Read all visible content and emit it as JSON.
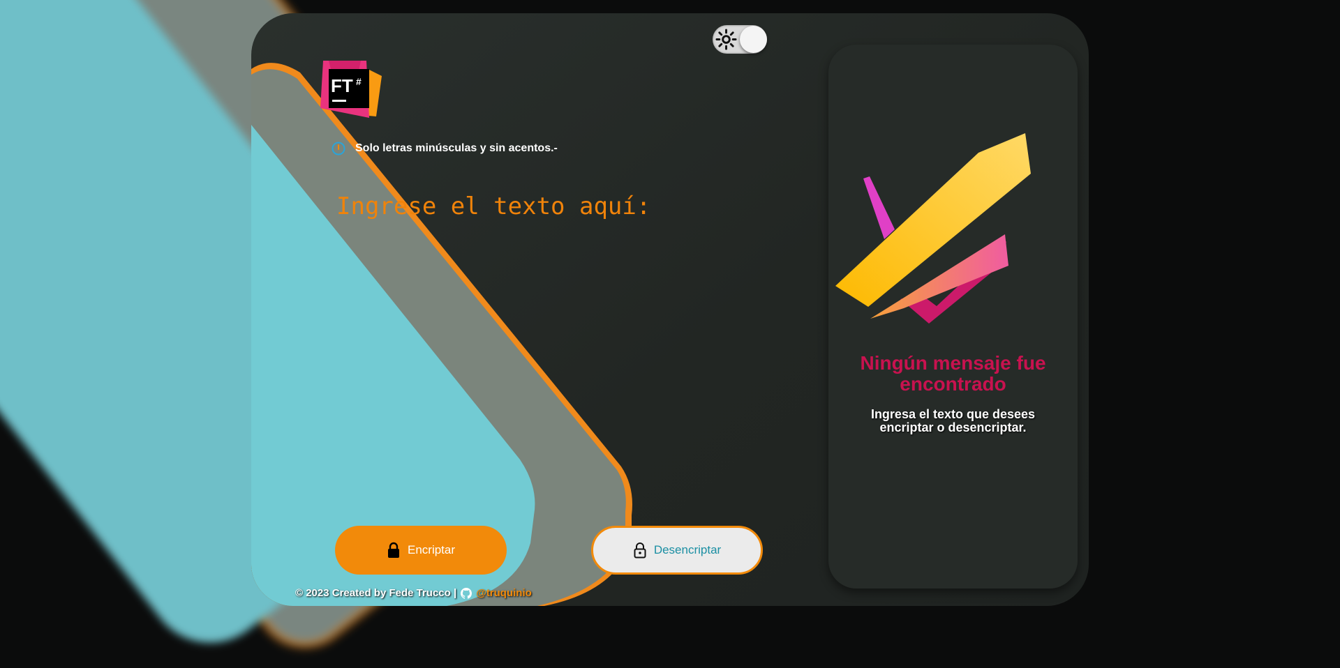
{
  "theme_toggle": {
    "icon": "sun-icon",
    "state": "light"
  },
  "logo": {
    "text": "FT",
    "symbol": "#"
  },
  "hint": {
    "icon": "info-icon",
    "text": "Solo letras minúsculas y sin acentos.-"
  },
  "input": {
    "placeholder": "Ingrese el texto aquí:",
    "value": ""
  },
  "buttons": {
    "encrypt": {
      "label": "Encriptar",
      "icon": "lock-closed-icon"
    },
    "decrypt": {
      "label": "Desencriptar",
      "icon": "lock-open-icon"
    }
  },
  "footer": {
    "text": "© 2023 Created by Fede Trucco |",
    "link_text": "@truquinio",
    "icon": "github-icon"
  },
  "result": {
    "title": "Ningún mensaje fue encontrado",
    "subtitle": "Ingresa el texto que desees encriptar o desencriptar."
  },
  "colors": {
    "accent": "#f28a0a",
    "title": "#c8124f",
    "teal": "#1b8fa3",
    "panel": "#262b28",
    "background": "#0b0c0c"
  }
}
